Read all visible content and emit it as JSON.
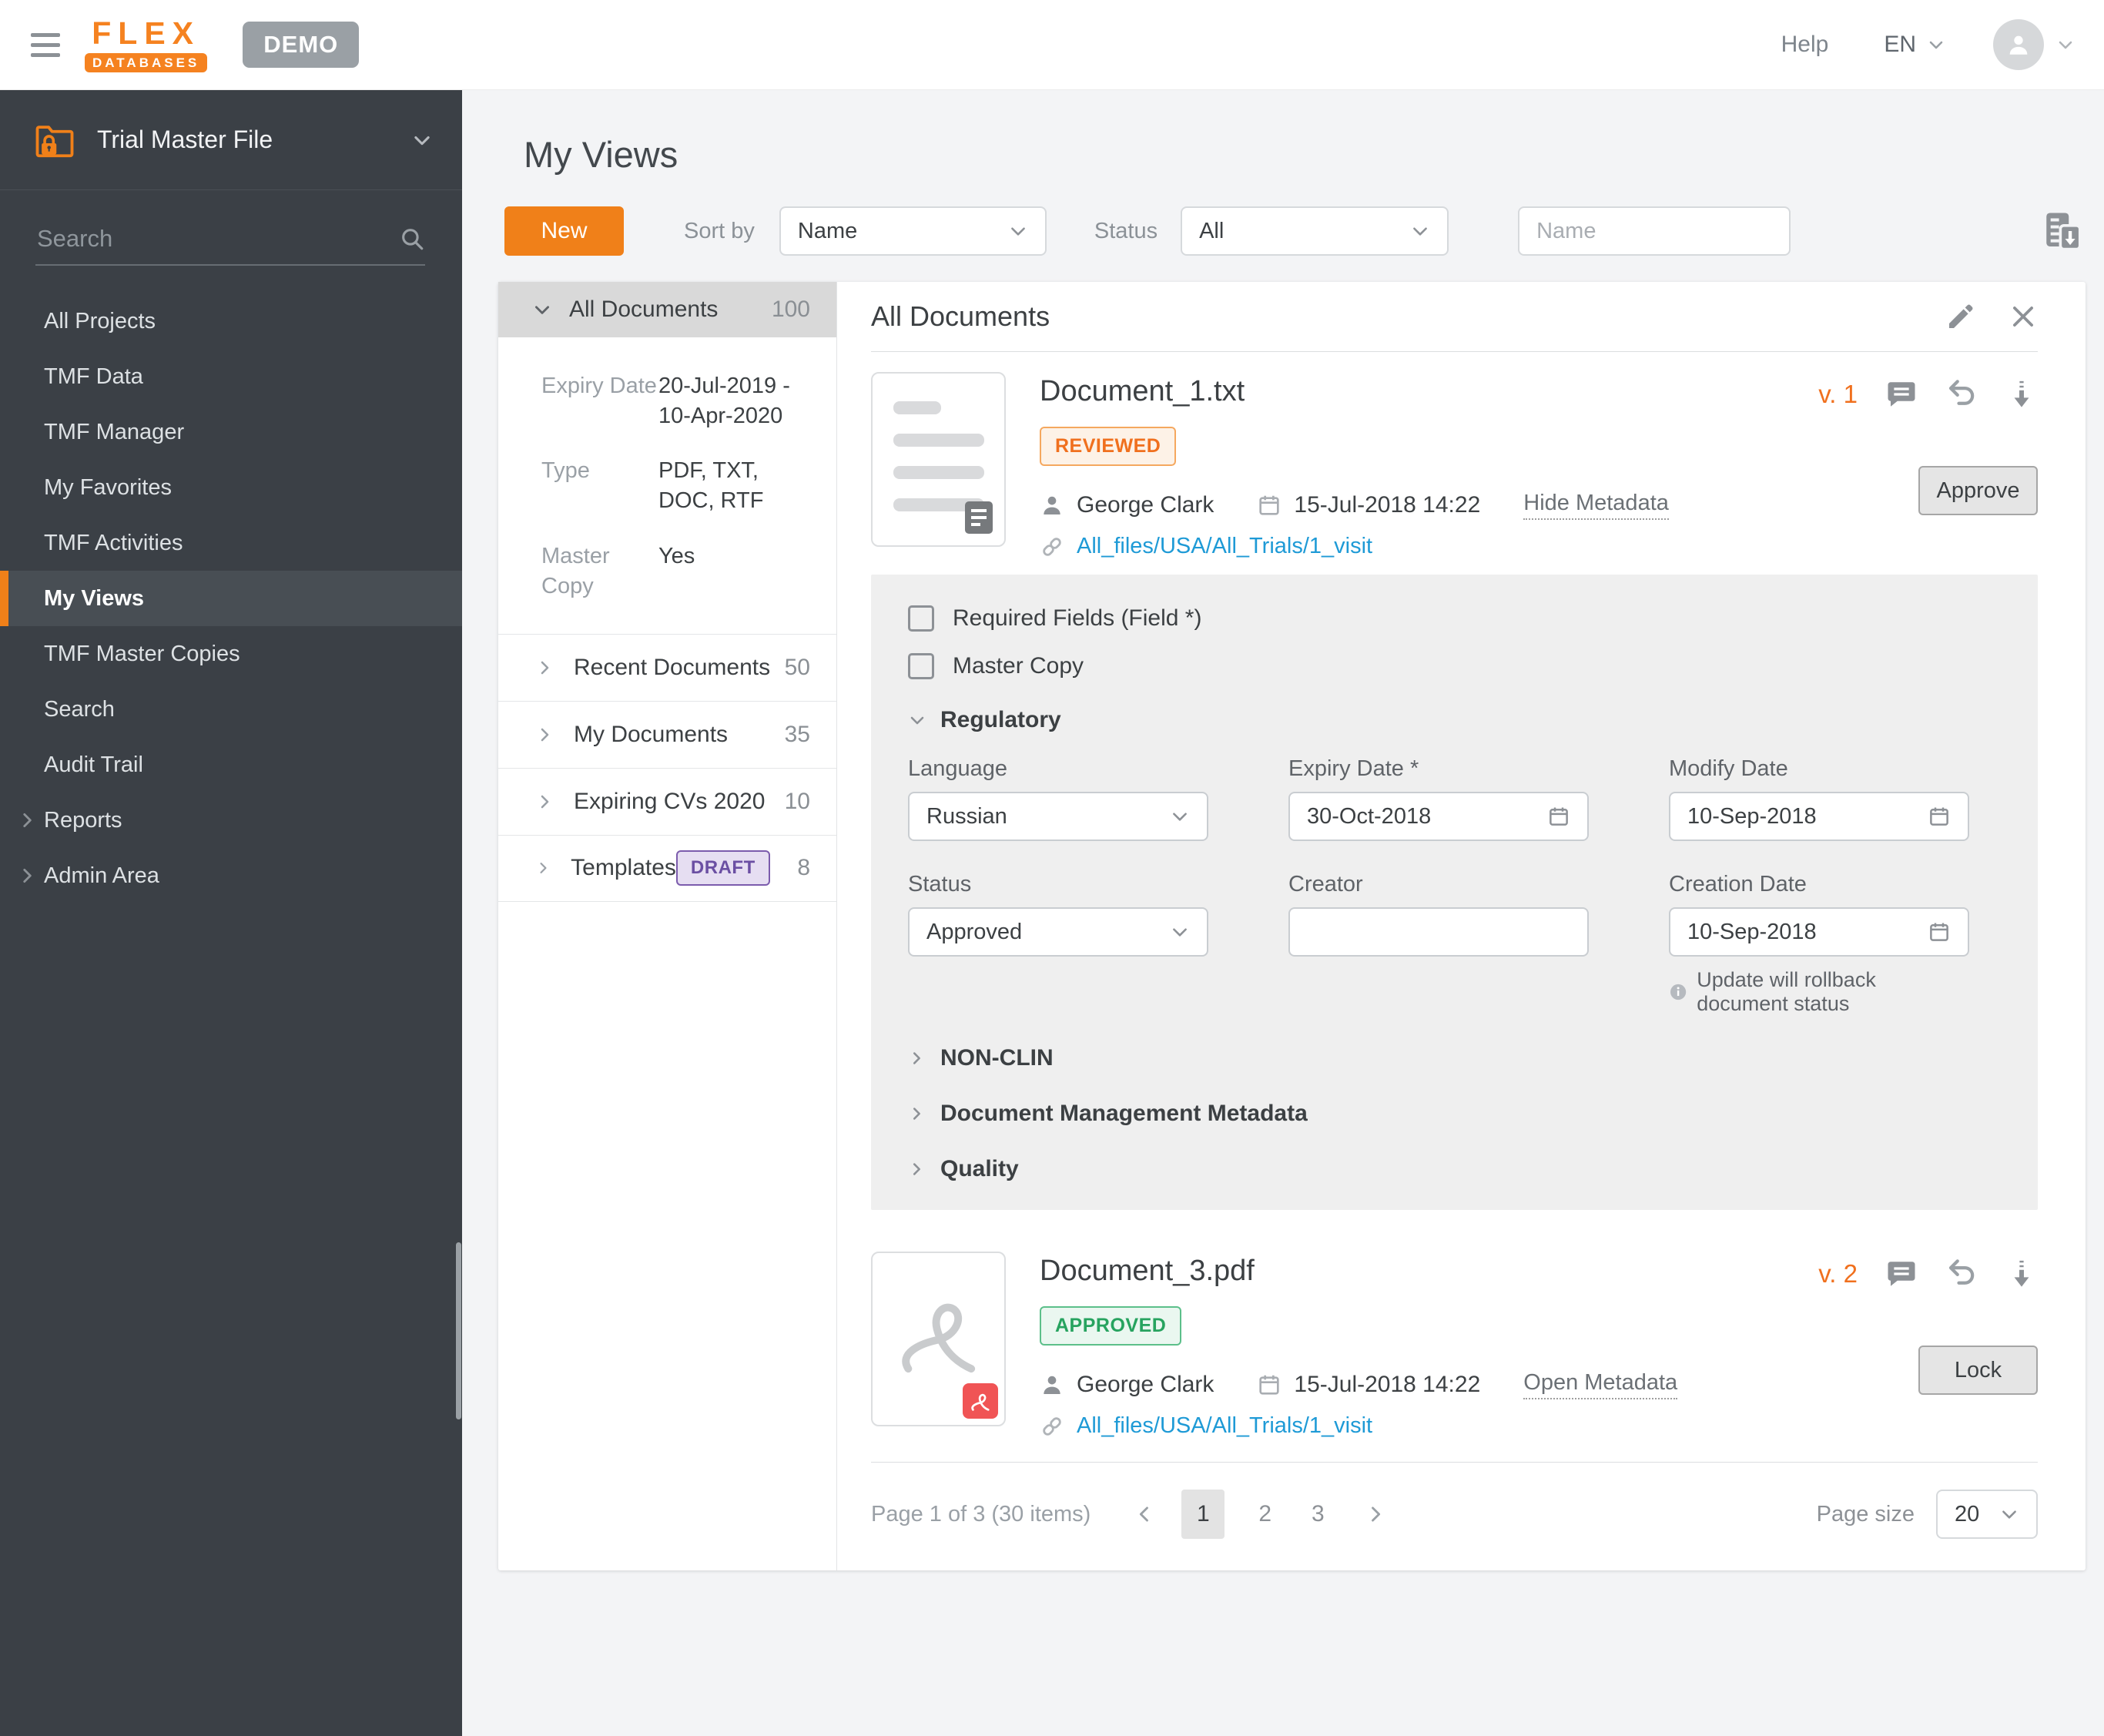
{
  "header": {
    "logo_top": "FLEX",
    "logo_bottom": "DATABASES",
    "demo_badge": "DEMO",
    "help": "Help",
    "language": "EN"
  },
  "sidebar": {
    "module_title": "Trial Master File",
    "search_placeholder": "Search",
    "items": [
      {
        "label": "All Projects"
      },
      {
        "label": "TMF Data"
      },
      {
        "label": "TMF Manager"
      },
      {
        "label": "My Favorites"
      },
      {
        "label": "TMF Activities"
      },
      {
        "label": "My Views",
        "active": true
      },
      {
        "label": "TMF Master Copies"
      },
      {
        "label": "Search"
      },
      {
        "label": "Audit Trail"
      },
      {
        "label": "Reports",
        "expandable": true
      },
      {
        "label": "Admin Area",
        "expandable": true
      }
    ]
  },
  "page": {
    "title": "My Views"
  },
  "toolbar": {
    "new_button": "New",
    "sort_by_label": "Sort by",
    "sort_by_value": "Name",
    "status_label": "Status",
    "status_value": "All",
    "filter_placeholder": "Name"
  },
  "views_panel": {
    "header_label": "All Documents",
    "header_count": "100",
    "details": [
      {
        "label": "Expiry Date",
        "value": "20-Jul-2019 - 10-Apr-2020"
      },
      {
        "label": "Type",
        "value": "PDF, TXT, DOC, RTF"
      },
      {
        "label": "Master Copy",
        "value": "Yes"
      }
    ],
    "views": [
      {
        "label": "Recent Documents",
        "count": "50"
      },
      {
        "label": "My Documents",
        "count": "35"
      },
      {
        "label": "Expiring CVs 2020",
        "count": "10"
      },
      {
        "label": "Templates",
        "badge": "DRAFT",
        "count": "8"
      }
    ]
  },
  "detail_panel": {
    "title": "All Documents",
    "documents": [
      {
        "name": "Document_1.txt",
        "status": "REVIEWED",
        "status_color": "#f0701e",
        "version": "v. 1",
        "author": "George Clark",
        "modified": "15-Jul-2018 14:22",
        "metadata_toggle": "Hide Metadata",
        "path": "All_files/USA/All_Trials/1_visit",
        "action": "Approve"
      },
      {
        "name": "Document_3.pdf",
        "status": "APPROVED",
        "status_color": "#27a35f",
        "version": "v. 2",
        "author": "George Clark",
        "modified": "15-Jul-2018 14:22",
        "metadata_toggle": "Open Metadata",
        "path": "All_files/USA/All_Trials/1_visit",
        "action": "Lock"
      }
    ],
    "metadata_form": {
      "checkboxes": [
        {
          "label": "Required Fields (Field *)",
          "checked": false
        },
        {
          "label": "Master Copy",
          "checked": false
        }
      ],
      "section": "Regulatory",
      "fields": [
        {
          "label": "Language",
          "value": "Russian",
          "type": "select"
        },
        {
          "label": "Expiry Date *",
          "value": "30-Oct-2018",
          "type": "date"
        },
        {
          "label": "Modify Date",
          "value": "10-Sep-2018",
          "type": "date"
        },
        {
          "label": "Status",
          "value": "Approved",
          "type": "select"
        },
        {
          "label": "Creator",
          "value": "",
          "type": "text"
        },
        {
          "label": "Creation Date",
          "value": "10-Sep-2018",
          "type": "date"
        }
      ],
      "info_note": "Update will rollback document status",
      "collapsed_sections": [
        "NON-CLIN",
        "Document Management Metadata",
        "Quality"
      ]
    },
    "pagination": {
      "summary": "Page 1 of 3  (30 items)",
      "pages": [
        "1",
        "2",
        "3"
      ],
      "active_page": "1",
      "page_size_label": "Page size",
      "page_size": "20"
    }
  },
  "colors": {
    "accent_orange": "#f08019",
    "sidebar_bg": "#3b4046",
    "link_blue": "#1e9ad6",
    "reviewed_orange": "#f0701e",
    "approved_green": "#27a35f",
    "draft_purple": "#6b4fa3"
  }
}
